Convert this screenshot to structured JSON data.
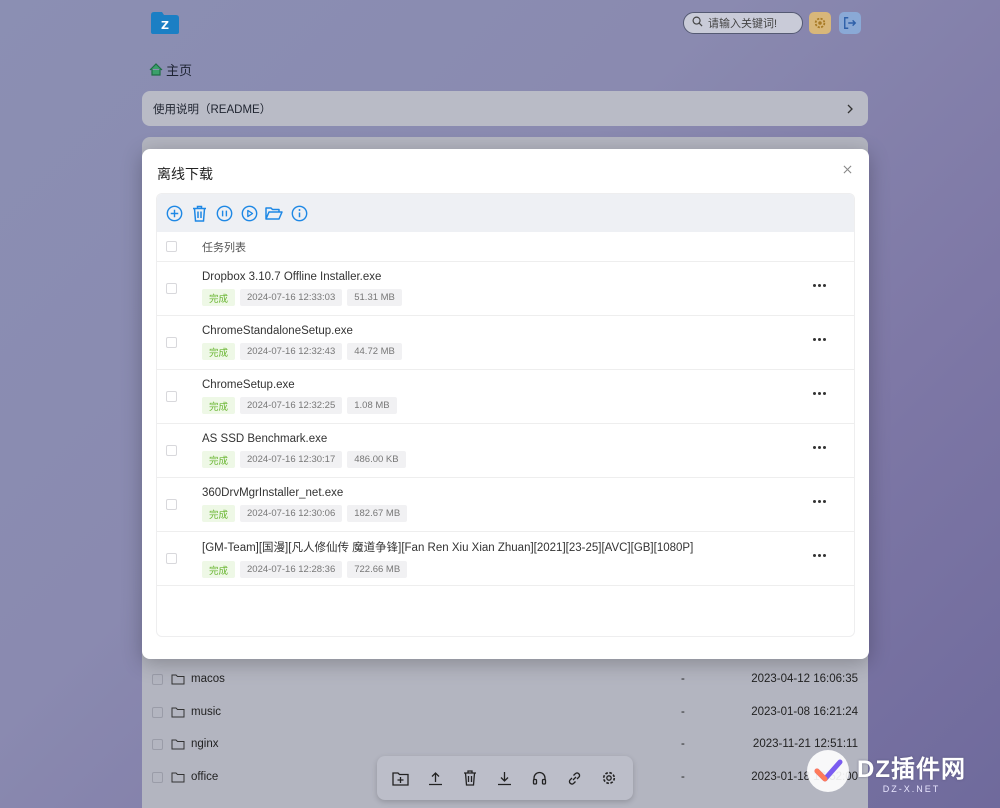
{
  "header": {
    "search_placeholder": "请输入关键词!"
  },
  "breadcrumb": {
    "home_label": "主页"
  },
  "readme": {
    "label": "使用说明（README）"
  },
  "background_rows": [
    {
      "name": "macos",
      "size": "-",
      "date": "2023-04-12 16:06:35"
    },
    {
      "name": "music",
      "size": "-",
      "date": "2023-01-08 16:21:24"
    },
    {
      "name": "nginx",
      "size": "-",
      "date": "2023-11-21 12:51:11"
    },
    {
      "name": "office",
      "size": "-",
      "date": "2023-01-18 16:52:00"
    }
  ],
  "modal": {
    "title": "离线下载",
    "list_header": "任务列表",
    "tasks": [
      {
        "name": "Dropbox 3.10.7 Offline Installer.exe",
        "status": "完成",
        "time": "2024-07-16 12:33:03",
        "size": "51.31 MB"
      },
      {
        "name": "ChromeStandaloneSetup.exe",
        "status": "完成",
        "time": "2024-07-16 12:32:43",
        "size": "44.72 MB"
      },
      {
        "name": "ChromeSetup.exe",
        "status": "完成",
        "time": "2024-07-16 12:32:25",
        "size": "1.08 MB"
      },
      {
        "name": "AS SSD Benchmark.exe",
        "status": "完成",
        "time": "2024-07-16 12:30:17",
        "size": "486.00 KB"
      },
      {
        "name": "360DrvMgrInstaller_net.exe",
        "status": "完成",
        "time": "2024-07-16 12:30:06",
        "size": "182.67 MB"
      },
      {
        "name": "[GM-Team][国漫][凡人修仙传 魔道争锋][Fan Ren Xiu Xian Zhuan][2021][23-25][AVC][GB][1080P]",
        "status": "完成",
        "time": "2024-07-16 12:28:36",
        "size": "722.66 MB"
      }
    ]
  },
  "watermark": {
    "main": "DZ插件网",
    "sub": "DZ-X.NET"
  },
  "colors": {
    "accent": "#1e88e5",
    "done_green": "#64b32a",
    "gear_bg": "#d8b77a"
  }
}
